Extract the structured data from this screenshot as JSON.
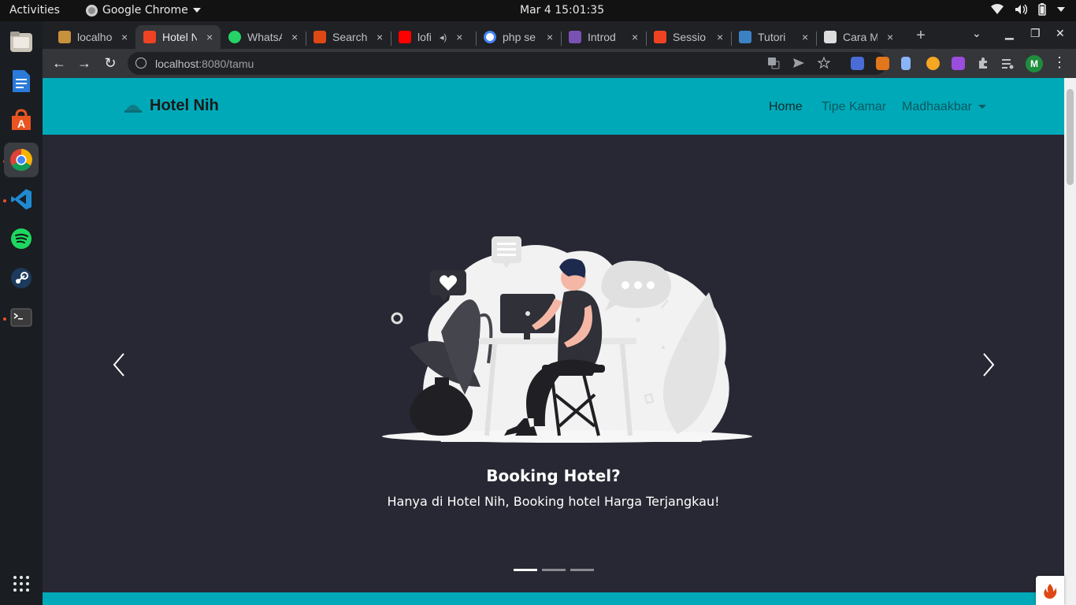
{
  "os": {
    "activities": "Activities",
    "app_name": "Google Chrome",
    "clock": "Mar 4  15:01:35"
  },
  "browser": {
    "tabs": [
      {
        "title": "localhost",
        "color": "#c8913d"
      },
      {
        "title": "Hotel Nih",
        "color": "#ee4323",
        "active": true
      },
      {
        "title": "WhatsApp",
        "color": "#25d366"
      },
      {
        "title": "Search",
        "color": "#dd4814"
      },
      {
        "title": "lofi",
        "color": "#ff0000"
      },
      {
        "title": "php se",
        "color": "#4285f4"
      },
      {
        "title": "Introd",
        "color": "#7952b3"
      },
      {
        "title": "Sessio",
        "color": "#ee4323"
      },
      {
        "title": "Tutori",
        "color": "#3b82c4"
      },
      {
        "title": "Cara M",
        "color": "#dddddd"
      }
    ],
    "tab_close": "×",
    "new_tab": "+",
    "url_host": "localhost",
    "url_port_path": ":8080/tamu"
  },
  "site": {
    "brand": "Hotel Nih",
    "nav": {
      "home": "Home",
      "room_types": "Tipe Kamar",
      "user": "Madhaakbar"
    },
    "carousel": {
      "title": "Booking Hotel?",
      "text": "Hanya di Hotel Nih, Booking hotel Harga Terjangkau!",
      "slides": 3,
      "active_slide": 1
    }
  },
  "colors": {
    "navbar": "#00a9b8",
    "hero_bg": "#272833",
    "accent_dock": "#e95420"
  }
}
